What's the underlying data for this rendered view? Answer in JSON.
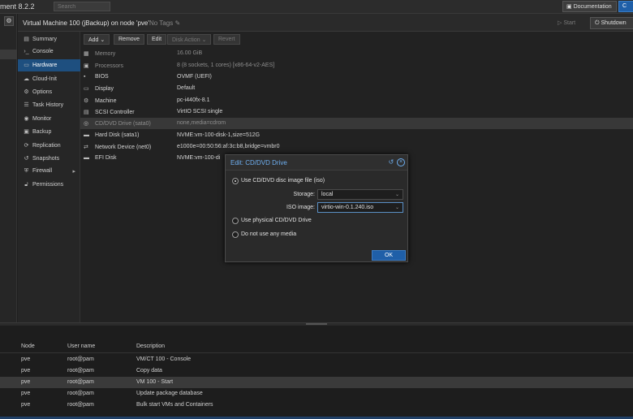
{
  "topbar": {
    "version": "ment 8.2.2",
    "search_placeholder": "Search",
    "documentation": "Documentation",
    "create_btn": "C"
  },
  "vm_header": {
    "title": "Virtual Machine 100 (jBackup) on node 'pve'",
    "tags": "No Tags",
    "start": "Start",
    "shutdown": "Shutdown"
  },
  "nav": {
    "items": [
      {
        "label": "Summary",
        "icon": "summary-icon"
      },
      {
        "label": "Console",
        "icon": "console-icon"
      },
      {
        "label": "Hardware",
        "icon": "hardware-icon"
      },
      {
        "label": "Cloud-Init",
        "icon": "cloud-icon"
      },
      {
        "label": "Options",
        "icon": "gear-icon"
      },
      {
        "label": "Task History",
        "icon": "list-icon"
      },
      {
        "label": "Monitor",
        "icon": "eye-icon"
      },
      {
        "label": "Backup",
        "icon": "floppy-icon"
      },
      {
        "label": "Replication",
        "icon": "refresh-icon"
      },
      {
        "label": "Snapshots",
        "icon": "history-icon"
      },
      {
        "label": "Firewall",
        "icon": "shield-icon"
      },
      {
        "label": "Permissions",
        "icon": "unlock-icon"
      }
    ]
  },
  "toolbar": {
    "add": "Add",
    "remove": "Remove",
    "edit": "Edit",
    "disk_action": "Disk Action",
    "revert": "Revert"
  },
  "hardware": [
    {
      "key": "Memory",
      "value": "16.00 GiB",
      "icon": "memory-icon"
    },
    {
      "key": "Processors",
      "value": "8 (8 sockets, 1 cores) [x86-64-v2-AES]",
      "icon": "cpu-icon"
    },
    {
      "key": "BIOS",
      "value": "OVMF (UEFI)",
      "icon": "chip-icon"
    },
    {
      "key": "Display",
      "value": "Default",
      "icon": "desktop-icon"
    },
    {
      "key": "Machine",
      "value": "pc-i440fx-8.1",
      "icon": "cogs-icon"
    },
    {
      "key": "SCSI Controller",
      "value": "VirtIO SCSI single",
      "icon": "database-icon"
    },
    {
      "key": "CD/DVD Drive (sata0)",
      "value": "none,media=cdrom",
      "icon": "cdrom-icon"
    },
    {
      "key": "Hard Disk (sata1)",
      "value": "NVME:vm-100-disk-1,size=512G",
      "icon": "hdd-icon"
    },
    {
      "key": "Network Device (net0)",
      "value": "e1000e=00:50:56:af:3c:b8,bridge=vmbr0",
      "icon": "exchange-icon"
    },
    {
      "key": "EFI Disk",
      "value": "NVME:vm-100-di",
      "icon": "hdd-icon"
    }
  ],
  "dialog": {
    "title": "Edit: CD/DVD Drive",
    "opt_iso": "Use CD/DVD disc image file (iso)",
    "storage_label": "Storage:",
    "storage_value": "local",
    "iso_label": "ISO image:",
    "iso_value": "virtio-win-0.1.240.iso",
    "opt_physical": "Use physical CD/DVD Drive",
    "opt_none": "Do not use any media",
    "ok": "OK"
  },
  "tasks": {
    "headers": [
      "Node",
      "User name",
      "Description"
    ],
    "rows": [
      {
        "node": "pve",
        "user": "root@pam",
        "desc": "VM/CT 100 - Console"
      },
      {
        "node": "pve",
        "user": "root@pam",
        "desc": "Copy data"
      },
      {
        "node": "pve",
        "user": "root@pam",
        "desc": "VM 100 - Start"
      },
      {
        "node": "pve",
        "user": "root@pam",
        "desc": "Update package database"
      },
      {
        "node": "pve",
        "user": "root@pam",
        "desc": "Bulk start VMs and Containers"
      }
    ]
  },
  "colors": {
    "accent": "#1f5fa8",
    "nav_active": "#1e4f7f",
    "dialog_title": "#6fb0f2"
  }
}
